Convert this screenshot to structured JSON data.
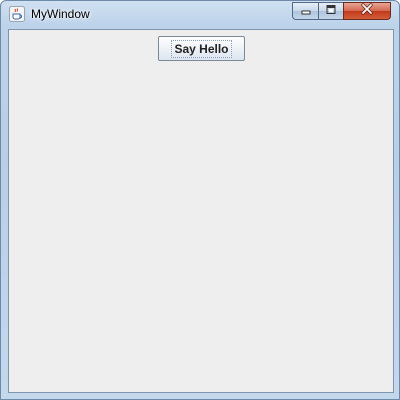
{
  "window": {
    "title": "MyWindow",
    "app_icon": "java-coffee-cup-icon",
    "controls": {
      "minimize": "minimize-icon",
      "maximize": "maximize-icon",
      "close": "close-icon"
    }
  },
  "content": {
    "say_hello_label": "Say Hello"
  },
  "colors": {
    "client_background": "#eeeeee",
    "close_button": "#c2391c",
    "frame": "#b9cfe6"
  }
}
